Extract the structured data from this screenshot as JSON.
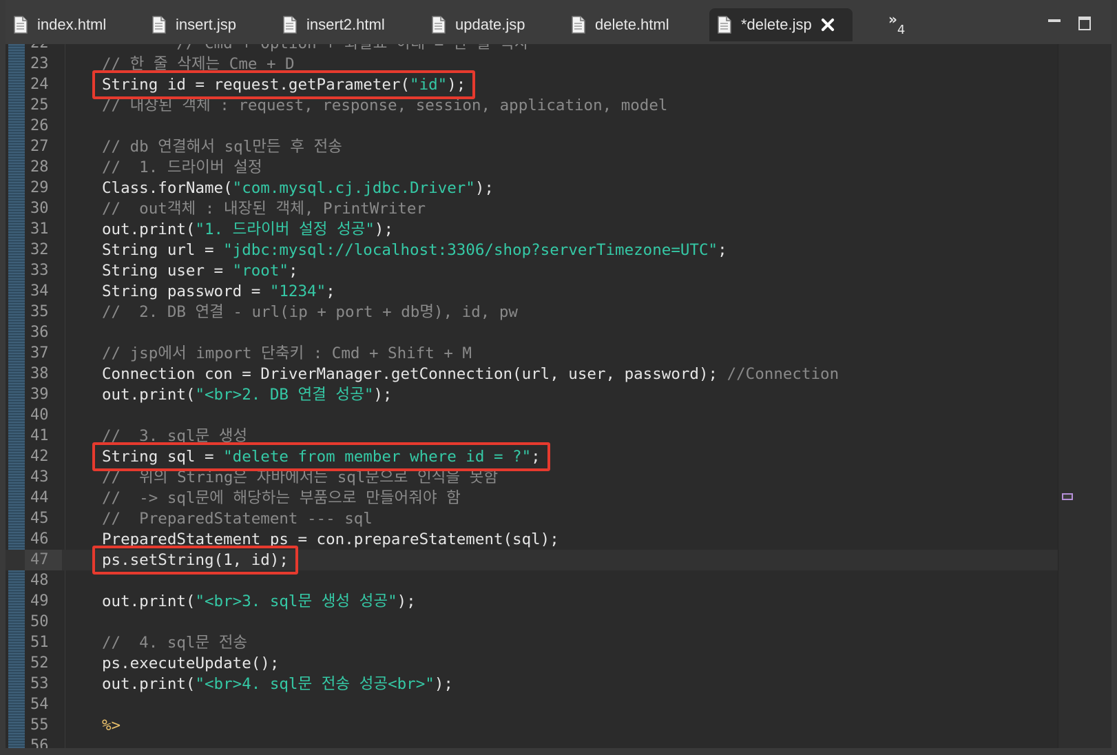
{
  "tabs": [
    {
      "label": "index.html",
      "active": false
    },
    {
      "label": "insert.jsp",
      "active": false
    },
    {
      "label": "insert2.html",
      "active": false
    },
    {
      "label": "update.jsp",
      "active": false
    },
    {
      "label": "delete.html",
      "active": false
    },
    {
      "label": "*delete.jsp",
      "active": true
    }
  ],
  "overflow": {
    "chevron": "»",
    "count": "4"
  },
  "colors": {
    "highlight_box": "#e63a2e",
    "string": "#35c9a6",
    "comment": "#8a8a8a",
    "jsp_tag": "#e8bf6a"
  },
  "icons": {
    "file": "file-doc-icon",
    "close": "close-icon",
    "overflow": "double-chevron-icon",
    "minimize": "minimize-icon",
    "maximize": "maximize-icon"
  },
  "current_line": 47,
  "highlighted_lines": [
    24,
    42,
    47
  ],
  "lines": [
    {
      "n": "22",
      "segs": [
        [
          "cmt",
          "        // Cmd + Option + 화살표 아래 = 한 줄 복사"
        ]
      ]
    },
    {
      "n": "23",
      "segs": [
        [
          "cmt",
          "// 한 줄 삭제는 Cme + D"
        ]
      ]
    },
    {
      "n": "24",
      "segs": [
        [
          "plain",
          "String id = request.getParameter("
        ],
        [
          "str",
          "\"id\""
        ],
        [
          "plain",
          ");"
        ]
      ]
    },
    {
      "n": "25",
      "segs": [
        [
          "cmt",
          "// 내장된 객체 : request, response, session, application, model"
        ]
      ]
    },
    {
      "n": "26",
      "segs": []
    },
    {
      "n": "27",
      "segs": [
        [
          "cmt",
          "// db 연결해서 sql만든 후 전송"
        ]
      ]
    },
    {
      "n": "28",
      "segs": [
        [
          "cmt",
          "//  1. 드라이버 설정"
        ]
      ]
    },
    {
      "n": "29",
      "segs": [
        [
          "plain",
          "Class.forName("
        ],
        [
          "str",
          "\"com.mysql.cj.jdbc.Driver\""
        ],
        [
          "plain",
          ");"
        ]
      ]
    },
    {
      "n": "30",
      "segs": [
        [
          "cmt",
          "//  out객체 : 내장된 객체, PrintWriter"
        ]
      ]
    },
    {
      "n": "31",
      "segs": [
        [
          "plain",
          "out.print("
        ],
        [
          "str",
          "\"1. 드라이버 설정 성공\""
        ],
        [
          "plain",
          ");"
        ]
      ]
    },
    {
      "n": "32",
      "segs": [
        [
          "plain",
          "String url = "
        ],
        [
          "str",
          "\"jdbc:mysql://localhost:3306/shop?serverTimezone=UTC\""
        ],
        [
          "plain",
          ";"
        ]
      ]
    },
    {
      "n": "33",
      "segs": [
        [
          "plain",
          "String user = "
        ],
        [
          "str",
          "\"root\""
        ],
        [
          "plain",
          ";"
        ]
      ]
    },
    {
      "n": "34",
      "segs": [
        [
          "plain",
          "String password = "
        ],
        [
          "str",
          "\"1234\""
        ],
        [
          "plain",
          ";"
        ]
      ]
    },
    {
      "n": "35",
      "segs": [
        [
          "cmt",
          "//  2. DB 연결 - url(ip + port + db명), id, pw"
        ]
      ]
    },
    {
      "n": "36",
      "segs": []
    },
    {
      "n": "37",
      "segs": [
        [
          "cmt",
          "// jsp에서 import 단축키 : Cmd + Shift + M"
        ]
      ]
    },
    {
      "n": "38",
      "segs": [
        [
          "plain",
          "Connection con = DriverManager.getConnection(url, user, password); "
        ],
        [
          "cmt",
          "//Connection"
        ]
      ]
    },
    {
      "n": "39",
      "segs": [
        [
          "plain",
          "out.print("
        ],
        [
          "str",
          "\"<br>2. DB 연결 성공\""
        ],
        [
          "plain",
          ");"
        ]
      ]
    },
    {
      "n": "40",
      "segs": []
    },
    {
      "n": "41",
      "segs": [
        [
          "cmt",
          "//  3. sql문 생성"
        ]
      ]
    },
    {
      "n": "42",
      "segs": [
        [
          "plain",
          "String sql = "
        ],
        [
          "str",
          "\"delete from member where id = ?\""
        ],
        [
          "plain",
          ";"
        ]
      ]
    },
    {
      "n": "43",
      "segs": [
        [
          "cmt",
          "//  위의 String은 자바에서는 sql문으로 인식을 못함"
        ]
      ]
    },
    {
      "n": "44",
      "segs": [
        [
          "cmt",
          "//  -> sql문에 해당하는 부품으로 만들어줘야 함"
        ]
      ]
    },
    {
      "n": "45",
      "segs": [
        [
          "cmt",
          "//  PreparedStatement --- sql"
        ]
      ]
    },
    {
      "n": "46",
      "segs": [
        [
          "plain",
          "PreparedStatement ps = con.prepareStatement(sql);"
        ]
      ]
    },
    {
      "n": "47",
      "segs": [
        [
          "plain",
          "ps.setString(1, id);"
        ]
      ]
    },
    {
      "n": "48",
      "segs": []
    },
    {
      "n": "49",
      "segs": [
        [
          "plain",
          "out.print("
        ],
        [
          "str",
          "\"<br>3. sql문 생성 성공\""
        ],
        [
          "plain",
          ");"
        ]
      ]
    },
    {
      "n": "50",
      "segs": []
    },
    {
      "n": "51",
      "segs": [
        [
          "cmt",
          "//  4. sql문 전송"
        ]
      ]
    },
    {
      "n": "52",
      "segs": [
        [
          "plain",
          "ps.executeUpdate();"
        ]
      ]
    },
    {
      "n": "53",
      "segs": [
        [
          "plain",
          "out.print("
        ],
        [
          "str",
          "\"<br>4. sql문 전송 성공<br>\""
        ],
        [
          "plain",
          ");"
        ]
      ]
    },
    {
      "n": "54",
      "segs": []
    },
    {
      "n": "55",
      "segs": [
        [
          "tag",
          "%>"
        ]
      ]
    },
    {
      "n": "56",
      "segs": []
    }
  ]
}
